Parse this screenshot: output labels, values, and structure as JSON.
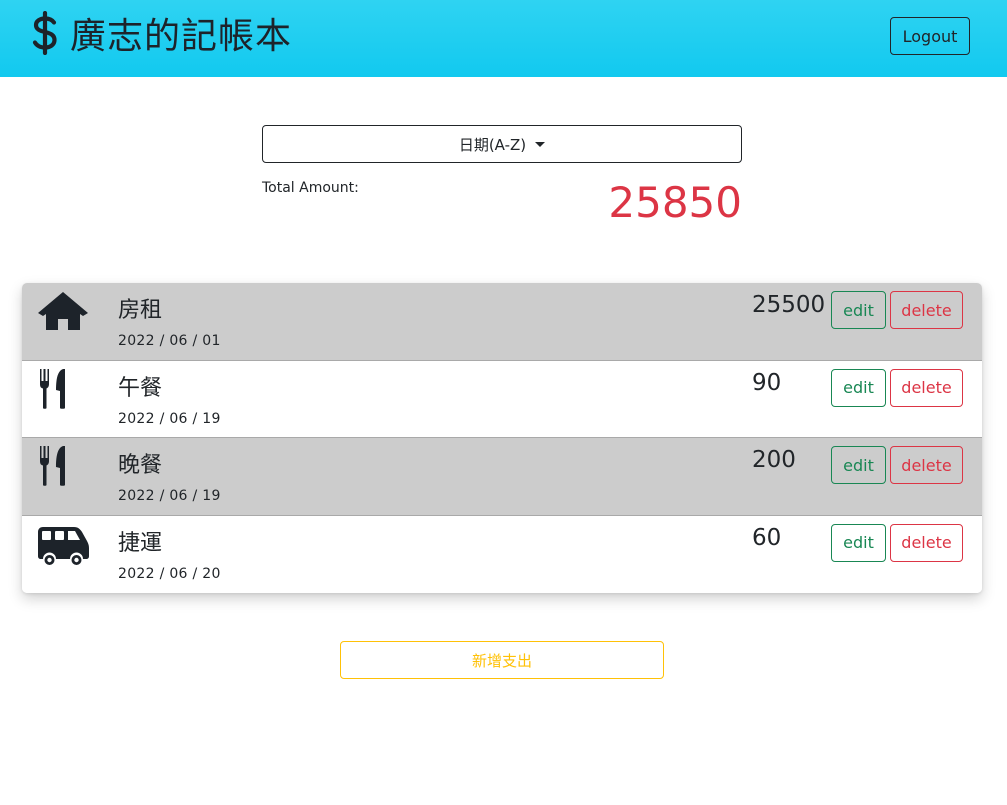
{
  "header": {
    "brand_icon": "dollar-sign-icon",
    "title": "廣志的記帳本",
    "logout_label": "Logout",
    "gradient_colors": [
      "#2fd3f2",
      "#12c9ef"
    ]
  },
  "sort": {
    "label": "日期(A-Z)",
    "icon": "caret-down-icon"
  },
  "summary": {
    "total_label": "Total Amount:",
    "total_value": "25850",
    "total_color": "#dc3545"
  },
  "records": [
    {
      "icon": "home-icon",
      "name": "房租",
      "date": "2022 / 06 / 01",
      "amount": "25500",
      "edit_label": "edit",
      "delete_label": "delete",
      "shaded": true
    },
    {
      "icon": "utensils-icon",
      "name": "午餐",
      "date": "2022 / 06 / 19",
      "amount": "90",
      "edit_label": "edit",
      "delete_label": "delete",
      "shaded": false
    },
    {
      "icon": "utensils-icon",
      "name": "晚餐",
      "date": "2022 / 06 / 19",
      "amount": "200",
      "edit_label": "edit",
      "delete_label": "delete",
      "shaded": true
    },
    {
      "icon": "shuttle-van-icon",
      "name": "捷運",
      "date": "2022 / 06 / 20",
      "amount": "60",
      "edit_label": "edit",
      "delete_label": "delete",
      "shaded": false
    }
  ],
  "actions": {
    "add_label": "新增支出"
  },
  "colors": {
    "row_shade": "#cccccc",
    "edit": "#198754",
    "delete": "#dc3545",
    "add": "#ffc107"
  }
}
